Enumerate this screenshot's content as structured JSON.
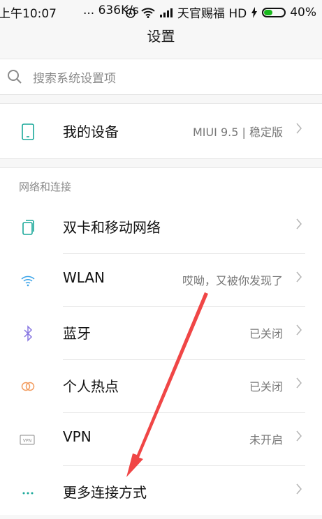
{
  "status_bar": {
    "time": "上午10:07",
    "speed": "... 636K/s",
    "carrier": "天官赐福 HD",
    "battery": "40%",
    "battery_level": 0.4
  },
  "header": {
    "title": "设置"
  },
  "search": {
    "placeholder": "搜索系统设置项"
  },
  "device": {
    "label": "我的设备",
    "value": "MIUI 9.5 | 稳定版"
  },
  "network_section": {
    "title": "网络和连接",
    "items": [
      {
        "label": "双卡和移动网络",
        "value": ""
      },
      {
        "label": "WLAN",
        "value": "哎呦，又被你发现了"
      },
      {
        "label": "蓝牙",
        "value": "已关闭"
      },
      {
        "label": "个人热点",
        "value": "已关闭"
      },
      {
        "label": "VPN",
        "value": "未开启"
      },
      {
        "label": "更多连接方式",
        "value": ""
      }
    ]
  },
  "colors": {
    "icon_teal": "#1aa89a",
    "icon_blue": "#3aa3e8",
    "icon_purple": "#8a79e2",
    "icon_orange": "#f29a5c",
    "arrow_red": "#f04646",
    "battery_green": "#19b81d"
  },
  "icons": {
    "device": "phone-outline-icon",
    "sim": "dual-sim-icon",
    "wlan": "wifi-icon",
    "bluetooth": "bluetooth-icon",
    "hotspot": "hotspot-icon",
    "vpn": "vpn-icon",
    "more": "more-dots-icon",
    "search": "search-icon",
    "chevron": "chevron-right-icon"
  }
}
